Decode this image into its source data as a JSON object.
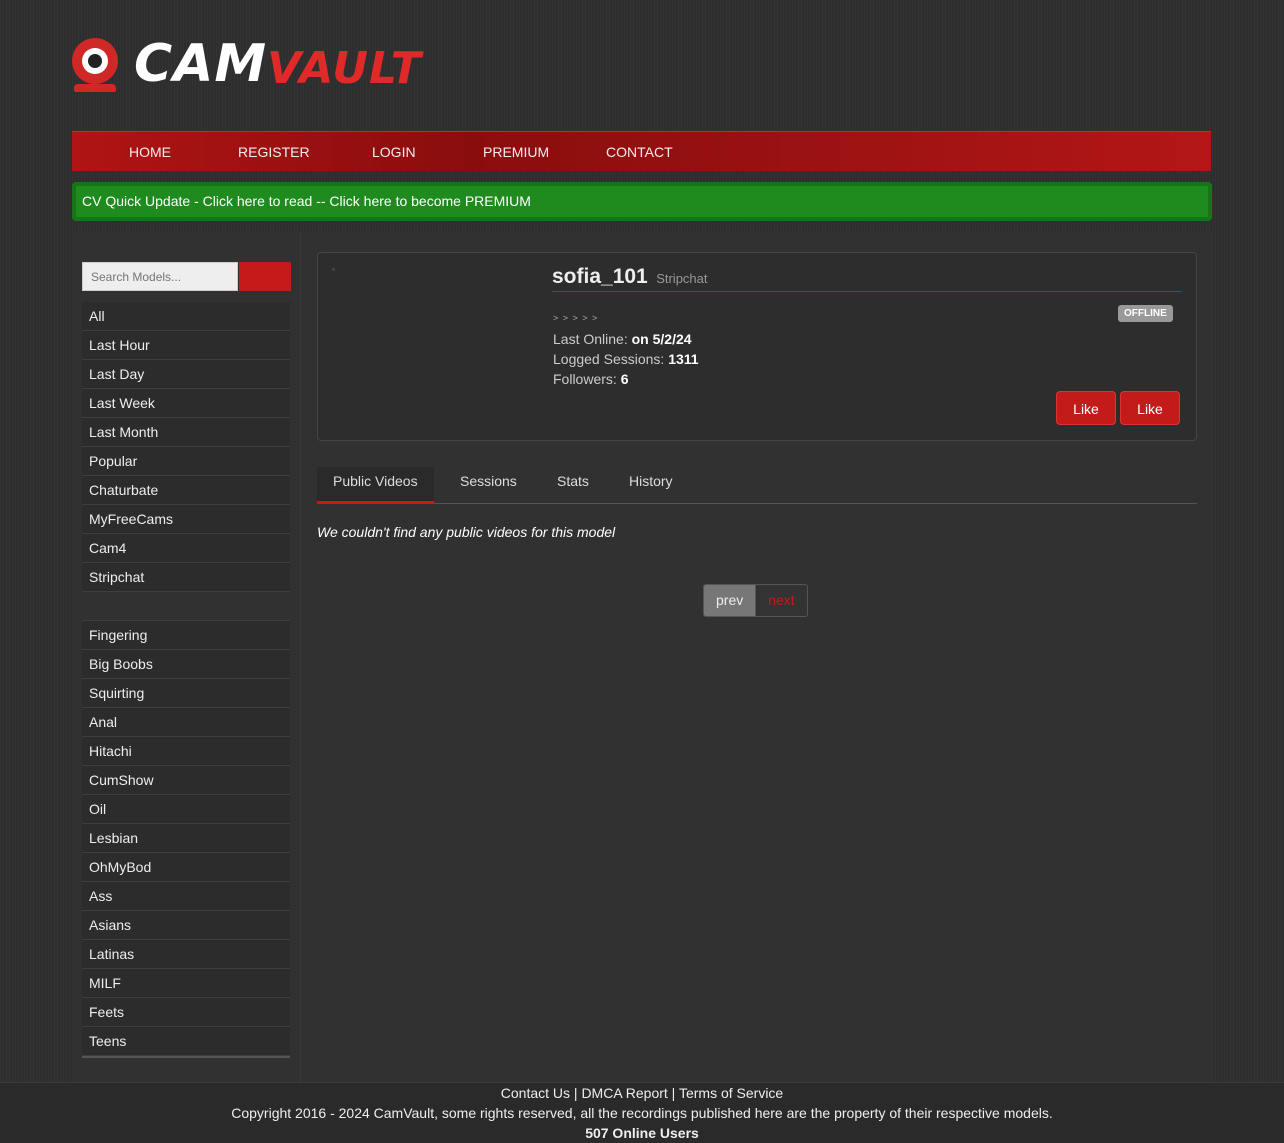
{
  "brand": {
    "word1": "CAM",
    "word2": "VAULT"
  },
  "nav": [
    "HOME",
    "REGISTER",
    "LOGIN",
    "PREMIUM",
    "CONTACT"
  ],
  "quick_update": {
    "label": "CV Quick Update",
    "text": " - Click here to read -- Click here to become PREMIUM"
  },
  "search": {
    "placeholder": "Search Models...",
    "btn1": "",
    "btn2": ""
  },
  "sidebar": {
    "filters": [
      "All",
      "Last Hour",
      "Last Day",
      "Last Week",
      "Last Month",
      "Popular",
      "Chaturbate",
      "MyFreeCams",
      "Cam4",
      "Stripchat"
    ],
    "tags": [
      "Fingering",
      "Big Boobs",
      "Squirting",
      "Anal",
      "Hitachi",
      "CumShow",
      "Oil",
      "Lesbian",
      "OhMyBod",
      "Ass",
      "Asians",
      "Latinas",
      "MILF",
      "Feets",
      "Teens"
    ]
  },
  "profile": {
    "icon": "",
    "name": "sofia_101",
    "platform": "Stripchat",
    "thumb": "▫",
    "stars": "˃ ˃ ˃ ˃ ˃",
    "status": "OFFLINE",
    "last_online_label": "Last Online: ",
    "last_online_value": "on 5/2/24",
    "sessions_label": "Logged Sessions: ",
    "sessions_value": "1311",
    "followers_label": "Followers: ",
    "followers_value": "6",
    "like1": " Like",
    "like2": " Like"
  },
  "tabs": [
    " Public Videos",
    " Sessions",
    " Stats",
    " History"
  ],
  "empty_message": "We couldn't find any public videos for this model",
  "pager": {
    "prev": "prev",
    "next": "next"
  },
  "footer": {
    "links": [
      "Contact Us",
      "DMCA Report",
      "Terms of Service"
    ],
    "sep": " | ",
    "copyright": "Copyright 2016 - 2024 CamVault, some rights reserved, all the recordings published here are the property of their respective models.",
    "online": "507 Online Users"
  }
}
